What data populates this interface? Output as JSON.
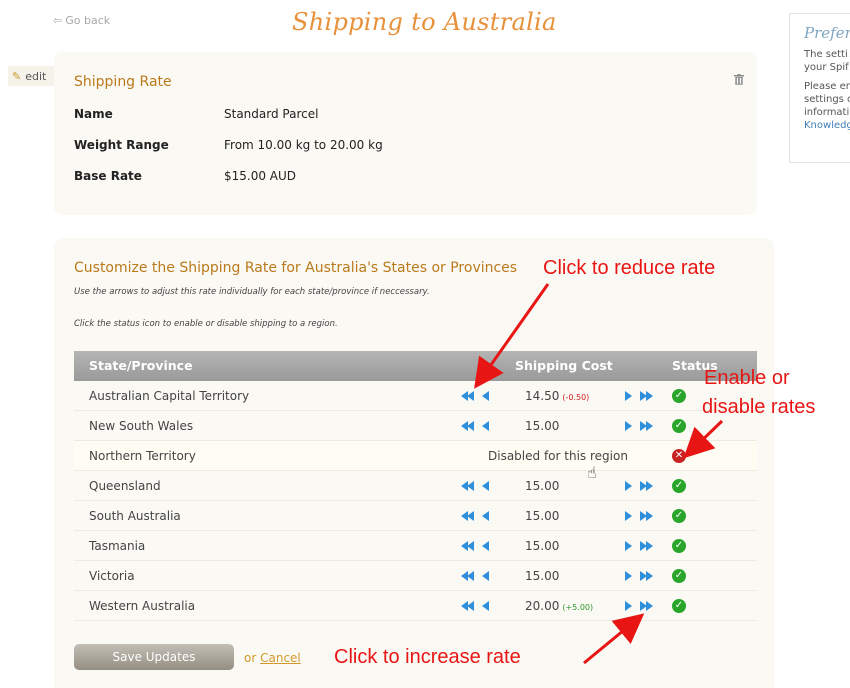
{
  "nav": {
    "go_back": "Go back"
  },
  "page": {
    "title": "Shipping to Australia"
  },
  "edit": {
    "label": "edit"
  },
  "preferences": {
    "title": "Prefer",
    "line1": "The setti",
    "line2": "your Spif",
    "line3": "Please en",
    "line4": "settings c",
    "line5": "informati",
    "link": "Knowledg"
  },
  "rate_card": {
    "title": "Shipping Rate",
    "rows": [
      {
        "key": "Name",
        "value": "Standard Parcel"
      },
      {
        "key": "Weight Range",
        "value": "From 10.00 kg to 20.00 kg"
      },
      {
        "key": "Base Rate",
        "value": "$15.00 AUD"
      }
    ]
  },
  "customize": {
    "title": "Customize the Shipping Rate for Australia's States or Provinces",
    "help1": "Use the arrows to adjust this rate individually for each state/province if neccessary.",
    "help2": "Click the status icon to enable or disable shipping to a region.",
    "headers": {
      "region": "State/Province",
      "cost": "Shipping Cost",
      "status": "Status"
    },
    "regions": [
      {
        "name": "Australian Capital Territory",
        "cost": "14.50",
        "delta": "(-0.50)",
        "delta_type": "neg",
        "enabled": true
      },
      {
        "name": "New South Wales",
        "cost": "15.00",
        "delta": "",
        "delta_type": "",
        "enabled": true
      },
      {
        "name": "Northern Territory",
        "cost": "",
        "delta": "",
        "delta_type": "",
        "enabled": false,
        "disabled_text": "Disabled for this region"
      },
      {
        "name": "Queensland",
        "cost": "15.00",
        "delta": "",
        "delta_type": "",
        "enabled": true
      },
      {
        "name": "South Australia",
        "cost": "15.00",
        "delta": "",
        "delta_type": "",
        "enabled": true
      },
      {
        "name": "Tasmania",
        "cost": "15.00",
        "delta": "",
        "delta_type": "",
        "enabled": true
      },
      {
        "name": "Victoria",
        "cost": "15.00",
        "delta": "",
        "delta_type": "",
        "enabled": true
      },
      {
        "name": "Western Australia",
        "cost": "20.00",
        "delta": "(+5.00)",
        "delta_type": "pos",
        "enabled": true
      }
    ],
    "save_label": "Save Updates",
    "or_text": "or",
    "cancel_label": "Cancel"
  },
  "annotations": {
    "reduce": "Click to reduce rate",
    "enable_line1": "Enable or",
    "enable_line2": "disable rates",
    "increase": "Click to increase rate"
  },
  "colors": {
    "title": "#e8913a",
    "section_title": "#b97a1b",
    "arrow_blue": "#2f8fdb",
    "status_on": "#29a52a",
    "status_off": "#c82424",
    "annotation_red": "#e81515"
  },
  "icons": {
    "back": "left-arrow-icon",
    "edit": "pencil-icon",
    "delete": "trash-icon",
    "decrease": "double-left-arrow-icon",
    "decrease_small": "single-left-arrow-icon",
    "increase_small": "single-right-arrow-icon",
    "increase": "double-right-arrow-icon",
    "enabled": "check-icon",
    "disabled": "x-icon",
    "cursor": "hand-pointer-icon"
  }
}
